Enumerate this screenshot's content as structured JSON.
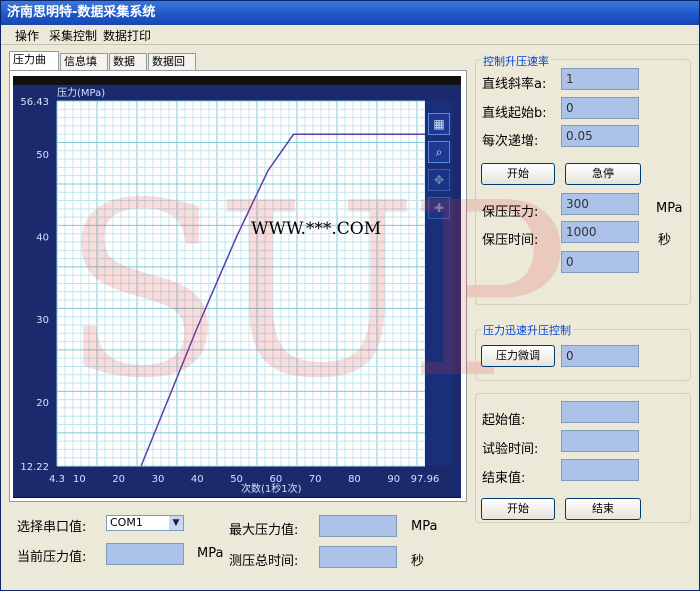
{
  "window": {
    "title": "济南思明特-数据采集系统"
  },
  "menu": [
    "操作",
    "采集控制",
    "数据打印"
  ],
  "tabs": [
    "压力曲线",
    "信息填写",
    "数据库",
    "数据回放"
  ],
  "colors": {
    "accent": "#0046d5",
    "field": "#adc2e8",
    "plot_line": "#5b3fa8"
  },
  "chart_data": {
    "type": "line",
    "ylabel": "压力(MPa)",
    "xlabel": "次数(1秒1次)",
    "xlim": [
      4.3,
      97.96
    ],
    "ylim": [
      12.22,
      56.43
    ],
    "x_ticks": [
      "4.3",
      "10",
      "20",
      "30",
      "40",
      "50",
      "60",
      "70",
      "80",
      "90",
      "97.96"
    ],
    "y_ticks": [
      "12.22",
      "20",
      "30",
      "40",
      "50",
      "56.43"
    ],
    "x": [
      25.7,
      40,
      50,
      58,
      64.5,
      97.96
    ],
    "y": [
      12.22,
      29,
      40,
      48,
      52.4,
      52.4
    ]
  },
  "watermark": "SUP",
  "overlay": "WWW.***.COM",
  "bottom": {
    "serial_label": "选择串口值:",
    "serial_value": "COM1",
    "max_pressure_label": "最大压力值:",
    "max_pressure_unit": "MPa",
    "current_label": "当前压力值:",
    "current_unit": "MPa",
    "total_time_label": "测压总时间:",
    "total_time_unit": "秒"
  },
  "rate_group": {
    "title": "控制升压速率",
    "slope_label": "直线斜率a:",
    "slope_value": "1",
    "intercept_label": "直线起始b:",
    "intercept_value": "0",
    "step_label": "每次递增:",
    "step_value": "0.05",
    "start_btn": "开始",
    "stop_btn": "急停",
    "hold_pressure_label": "保压压力:",
    "hold_pressure_value": "300",
    "hold_pressure_unit": "MPa",
    "hold_time_label": "保压时间:",
    "hold_time_value": "1000",
    "hold_time_unit": "秒",
    "extra_value": "0"
  },
  "fast_group": {
    "title": "压力迅速升压控制",
    "fine_btn": "压力微调",
    "fine_value": "0"
  },
  "test_group": {
    "start_label": "起始值:",
    "time_label": "试验时间:",
    "end_label": "结束值:",
    "start_btn": "开始",
    "end_btn": "结束"
  }
}
